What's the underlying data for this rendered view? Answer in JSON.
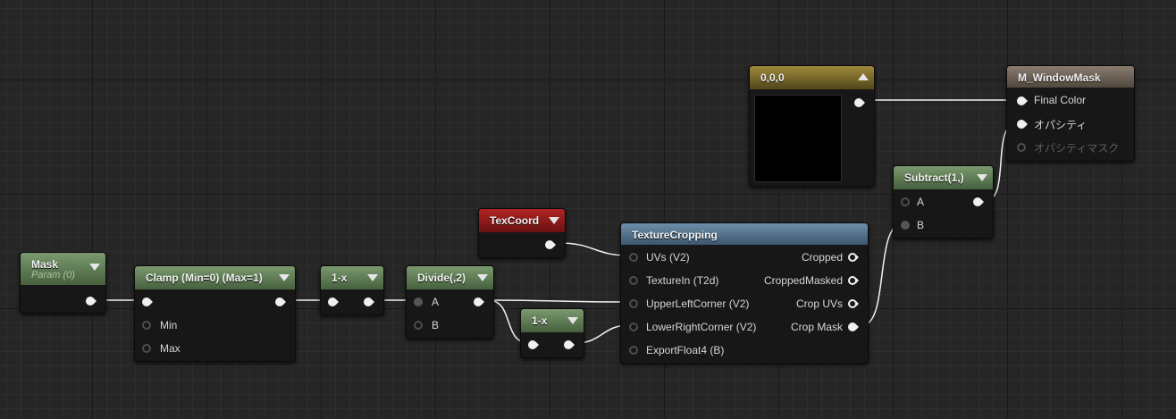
{
  "nodes": {
    "mask": {
      "title": "Mask",
      "subtitle": "Param (0)"
    },
    "clamp": {
      "title": "Clamp (Min=0) (Max=1)",
      "pins": {
        "min": "Min",
        "max": "Max"
      }
    },
    "one_minus_a": {
      "title": "1-x"
    },
    "divide": {
      "title": "Divide(,2)",
      "pins": {
        "a": "A",
        "b": "B"
      }
    },
    "one_minus_b": {
      "title": "1-x"
    },
    "texcoord": {
      "title": "TexCoord"
    },
    "texture_cropping": {
      "title": "TextureCropping",
      "inputs": [
        "UVs (V2)",
        "TextureIn (T2d)",
        "UpperLeftCorner (V2)",
        "LowerRightCorner (V2)",
        "ExportFloat4 (B)"
      ],
      "outputs": [
        "Cropped",
        "CroppedMasked",
        "Crop UVs",
        "Crop Mask"
      ]
    },
    "constant": {
      "title": "0,0,0"
    },
    "subtract": {
      "title": "Subtract(1,)",
      "pins": {
        "a": "A",
        "b": "B"
      }
    },
    "material": {
      "title": "M_WindowMask",
      "pins": [
        "Final Color",
        "オパシティ",
        "オパシティマスク"
      ]
    }
  },
  "colors": {
    "background": "#262626",
    "header_green": "#5f7d55",
    "header_blue": "#557490",
    "header_red": "#8f1a1a",
    "header_gold": "#7d6c2a",
    "header_brown": "#6b6156",
    "wire": "#f2f2f2"
  },
  "icons": [
    "collapse-arrow-down-icon",
    "collapse-arrow-up-icon",
    "pin-connected-icon",
    "pin-unconnected-icon"
  ]
}
